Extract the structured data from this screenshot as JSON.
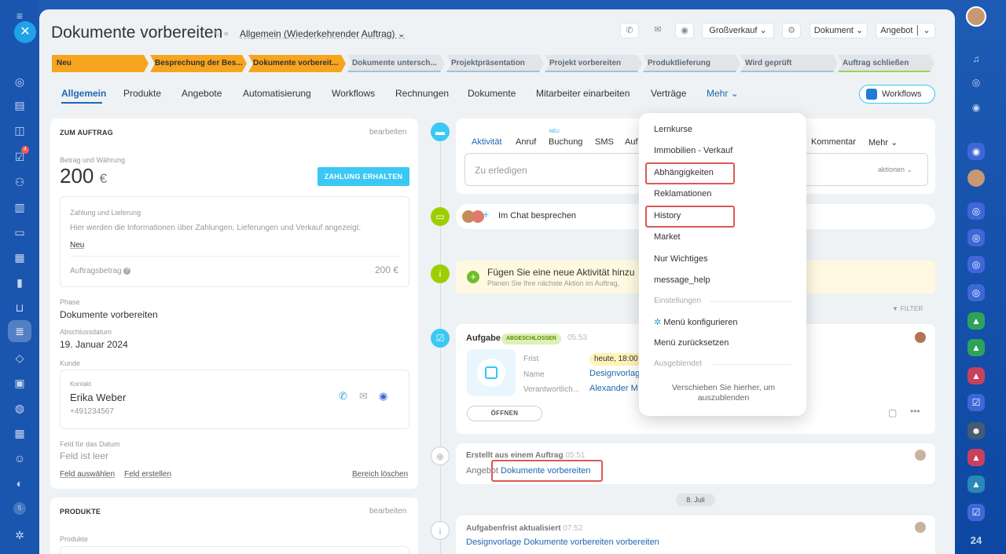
{
  "header": {
    "title": "Dokumente vorbereiten",
    "subtitle": "Allgemein (Wiederkehrender Auftrag)",
    "buttons": {
      "grossverkauf": "Großverkauf",
      "dokument": "Dokument",
      "angebot": "Angebot"
    }
  },
  "pipeline": [
    {
      "label": "Neu",
      "state": "done"
    },
    {
      "label": "Besprechung der Bes...",
      "state": "done"
    },
    {
      "label": "Dokumente vorbereit...",
      "state": "done"
    },
    {
      "label": "Dokumente untersch...",
      "state": "todo"
    },
    {
      "label": "Projektpräsentation",
      "state": "todo"
    },
    {
      "label": "Projekt vorbereiten",
      "state": "todo"
    },
    {
      "label": "Produktlieferung",
      "state": "todo"
    },
    {
      "label": "Wird geprüft",
      "state": "todo"
    },
    {
      "label": "Auftrag schließen",
      "state": "final"
    }
  ],
  "tabs": [
    "Allgemein",
    "Produkte",
    "Angebote",
    "Automatisierung",
    "Workflows",
    "Rechnungen",
    "Dokumente",
    "Mitarbeiter einarbeiten",
    "Verträge",
    "Mehr"
  ],
  "workflows_button": "Workflows",
  "order_card": {
    "head": "ZUM AUFTRAG",
    "edit": "bearbeiten",
    "amount_label": "Betrag und Währung",
    "amount": "200",
    "currency": "€",
    "pay_button": "ZAHLUNG ERHALTEN",
    "payment_label": "Zahlung und Lieferung",
    "payment_text": "Hier werden die Informationen über Zahlungen, Lieferungen und Verkauf angezeigt.",
    "new_link": "Neu",
    "order_amount_label": "Auftragsbetrag",
    "order_amount": "200 €",
    "phase_label": "Phase",
    "phase": "Dokumente vorbereiten",
    "close_label": "Abschlussdatum",
    "close_date": "19. Januar 2024",
    "customer_label": "Kunde",
    "contact_label": "Kontakt",
    "contact_name": "Erika Weber",
    "contact_phone": "+491234567",
    "date_field_label": "Feld für das Datum",
    "date_field_value": "Feld ist leer",
    "choose_field": "Feld auswählen",
    "create_field": "Feld erstellen",
    "delete_section": "Bereich löschen"
  },
  "products_card": {
    "head": "PRODUKTE",
    "edit": "bearbeiten",
    "label": "Produkte"
  },
  "activity": {
    "tabs": [
      "Aktivität",
      "Anruf",
      "Buchung",
      "SMS",
      "Auf",
      "Kommentar",
      "Mehr"
    ],
    "new_badge": "NEU",
    "todo_placeholder": "Zu erledigen",
    "actions": "aktionen",
    "chat": "Im Chat besprechen",
    "add_title": "Fügen Sie eine neue Aktivität hinzu",
    "add_sub": "Planen Sie Ihre nächste Aktion im Auftrag,",
    "filter": "FILTER"
  },
  "task": {
    "title": "Aufgabe",
    "status": "ABGESCHLOSSEN",
    "time": "05:53",
    "deadline_label": "Frist",
    "deadline": "heute, 18:00",
    "name_label": "Name",
    "name": "Designvorlag",
    "resp_label": "Verantwortlich...",
    "resp": "Alexander M",
    "open": "ÖFFNEN"
  },
  "created": {
    "title": "Erstellt aus einem Auftrag",
    "time": "05:51",
    "prefix": "Angebot",
    "link": "Dokumente vorbereiten"
  },
  "date_sep": "8. Juli",
  "deadline_update": {
    "title": "Aufgabenfrist aktualisiert",
    "time": "07:52",
    "link": "Designvorlage Dokumente vorbereiten vorbereiten"
  },
  "dropdown": {
    "items": [
      "Lernkurse",
      "Immobilien - Verkauf",
      "Abhängigkeiten",
      "Reklamationen",
      "History",
      "Market",
      "Nur Wichtiges",
      "message_help"
    ],
    "settings_label": "Einstellungen",
    "configure": "Menü konfigurieren",
    "reset": "Menü zurücksetzen",
    "hidden_label": "Ausgeblendet",
    "hint": "Verschieben Sie hierher, um auszublenden"
  },
  "sidebar": {
    "badge_count": "4",
    "bottom_badge": "5"
  },
  "rightbar": {
    "counter": "24"
  },
  "colors": {
    "accent": "#2067b0",
    "stage_done": "#f7a51e",
    "highlight": "#d95a55",
    "button": "#3bc8f5"
  }
}
